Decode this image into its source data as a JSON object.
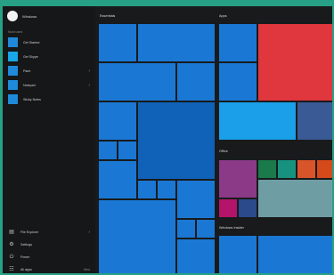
{
  "user": {
    "name": "Windows"
  },
  "left_panel": {
    "section_label": "Most used",
    "apps": [
      {
        "label": "Get Started",
        "has_arrow": false
      },
      {
        "label": "Get Skype",
        "has_arrow": false
      },
      {
        "label": "Paint",
        "has_arrow": true
      },
      {
        "label": "Notepad",
        "has_arrow": true
      },
      {
        "label": "Sticky Notes",
        "has_arrow": false
      }
    ],
    "bottom": {
      "file_explorer": "File Explorer",
      "settings": "Settings",
      "power": "Power",
      "all_apps": "All apps",
      "all_apps_extra": "New"
    }
  },
  "groups": {
    "essentials": "Essentials",
    "apps": "Apps",
    "office": "Office",
    "windows_insider": "Windows Insider"
  },
  "colors": {
    "background": "#27a085",
    "start_bg": "#181a1c",
    "tile_blue": "#1a78d4",
    "tile_red": "#e0363d",
    "tile_lightblue": "#1a9fe8",
    "tile_slate": "#3a5a95",
    "tile_purple": "#8a3a86",
    "tile_green": "#1a7a4a",
    "tile_teal": "#17927e",
    "tile_orange": "#d9542a",
    "tile_orangered": "#d44a1a",
    "tile_magenta": "#b4146a",
    "tile_navy": "#2a4a8c",
    "tile_grayteal": "#6e9ea4"
  }
}
